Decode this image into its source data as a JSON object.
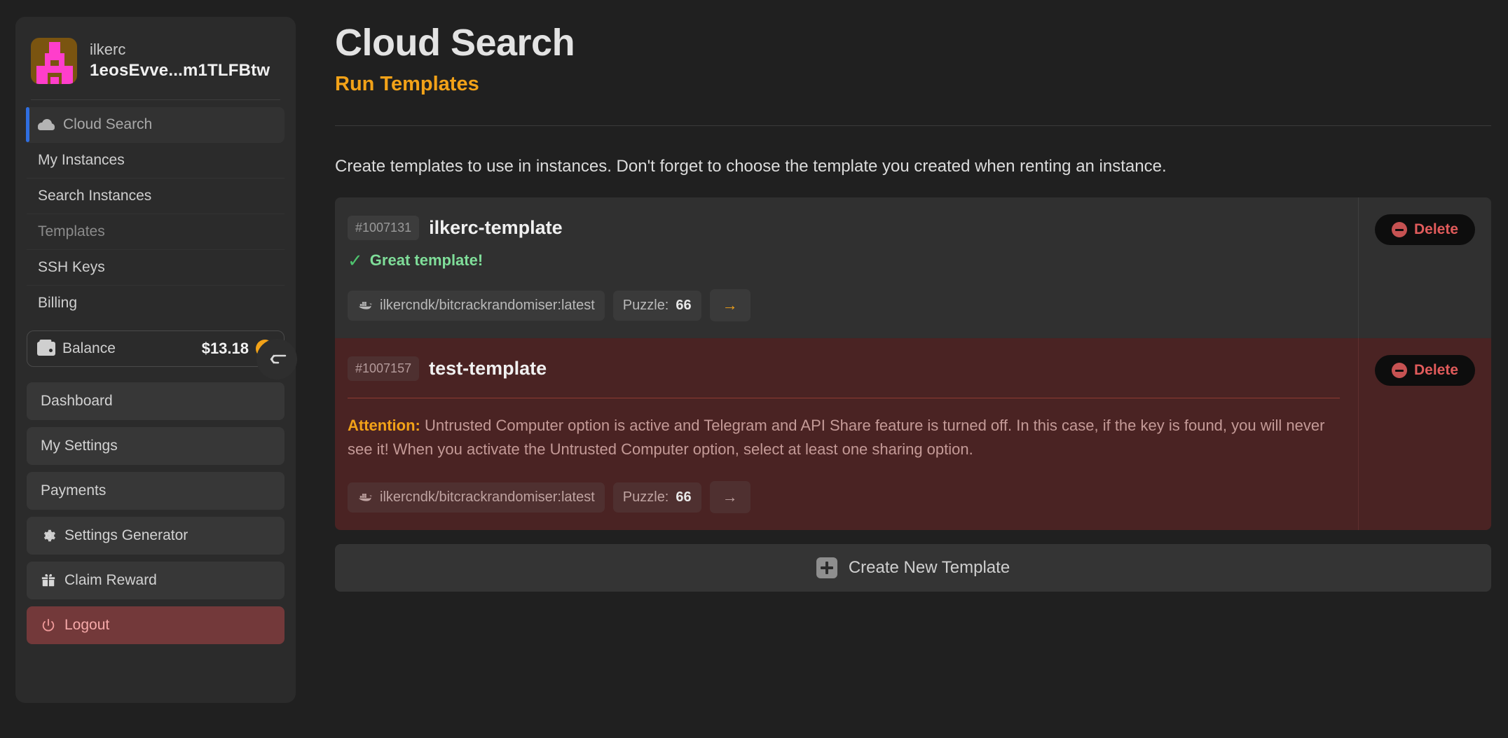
{
  "sidebar": {
    "profile": {
      "username": "ilkerc",
      "address": "1eosEvve...m1TLFBtw",
      "avatar_icon": "identicon-avatar"
    },
    "nav_top": [
      {
        "label": "Cloud Search",
        "icon": "cloud-icon",
        "state": "active"
      },
      {
        "label": "My Instances",
        "icon": "",
        "state": "normal"
      },
      {
        "label": "Search Instances",
        "icon": "",
        "state": "normal"
      },
      {
        "label": "Templates",
        "icon": "",
        "state": "dim"
      },
      {
        "label": "SSH Keys",
        "icon": "",
        "state": "normal"
      },
      {
        "label": "Billing",
        "icon": "",
        "state": "normal"
      }
    ],
    "balance": {
      "label": "Balance",
      "amount": "$13.18",
      "icon": "wallet-icon",
      "add_icon": "plus-circle-icon"
    },
    "nav_bottom": [
      {
        "label": "Dashboard",
        "icon": ""
      },
      {
        "label": "My Settings",
        "icon": ""
      },
      {
        "label": "Payments",
        "icon": ""
      },
      {
        "label": "Settings Generator",
        "icon": "gear-icon"
      },
      {
        "label": "Claim Reward",
        "icon": "gift-icon"
      },
      {
        "label": "Logout",
        "icon": "power-icon"
      }
    ],
    "collapse_icon": "collapse-arrow-icon"
  },
  "header": {
    "title": "Cloud Search",
    "subtitle": "Run Templates"
  },
  "main": {
    "intro": "Create templates to use in instances. Don't forget to choose the template you created when renting an instance.",
    "delete_label": "Delete",
    "create_label": "Create New Template",
    "templates": [
      {
        "id": "#1007131",
        "name": "ilkerc-template",
        "status_text": "Great template!",
        "status_icon": "check-icon",
        "image": "ilkercndk/bitcrackrandomiser:latest",
        "image_icon": "docker-icon",
        "puzzle_label": "Puzzle:",
        "puzzle_value": "66",
        "run_icon": "arrow-right-icon"
      },
      {
        "id": "#1007157",
        "name": "test-template",
        "attention_label": "Attention:",
        "attention_text": " Untrusted Computer option is active and Telegram and API Share feature is turned off. In this case, if the key is found, you will never see it! When you activate the Untrusted Computer option, select at least one sharing option.",
        "image": "ilkercndk/bitcrackrandomiser:latest",
        "image_icon": "docker-icon",
        "puzzle_label": "Puzzle:",
        "puzzle_value": "66",
        "run_icon": "arrow-right-icon"
      }
    ]
  },
  "colors": {
    "accent_orange": "#f2a218",
    "active_blue": "#2f6ee0",
    "success_green": "#7fdd99",
    "danger_red": "#e05b5b",
    "warn_card_bg": "#4a2323"
  }
}
